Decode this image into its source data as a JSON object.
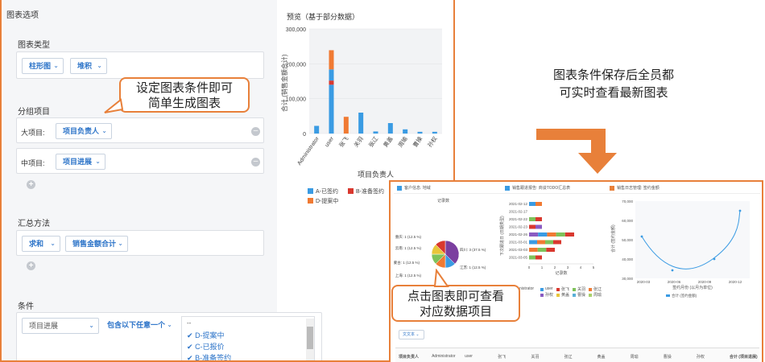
{
  "settings": {
    "title": "图表选项",
    "chart_type": {
      "title": "图表类型",
      "type_value": "柱形图",
      "mode_value": "堆积"
    },
    "grouping": {
      "title": "分组项目",
      "major_label": "大项目:",
      "major_value": "项目负责人",
      "minor_label": "中项目:",
      "minor_value": "项目进展"
    },
    "aggregation": {
      "title": "汇总方法",
      "method_value": "求和",
      "field_value": "销售金额合计"
    },
    "conditions": {
      "title": "条件",
      "field_value": "项目进展",
      "operator_value": "包含以下任意一个",
      "options": [
        "--",
        "D-提案中",
        "C-已报价",
        "B-准备签约"
      ],
      "checked": [
        false,
        true,
        true,
        true
      ]
    }
  },
  "callouts": {
    "left": [
      "设定图表条件即可",
      "简单生成图表"
    ],
    "bottom": [
      "点击图表即可查看",
      "对应数据项目"
    ],
    "caption": [
      "图表条件保存后全员都",
      "可实时查看最新图表"
    ]
  },
  "preview": {
    "title": "预览（基于部分数据）"
  },
  "chart_data": {
    "type": "bar",
    "stacked": true,
    "ylabel": "合计 (销售金额合计)",
    "xlabel": "项目负责人",
    "ylim": [
      0,
      300000
    ],
    "yticks": [
      "300,000",
      "200,000",
      "100,000",
      "0"
    ],
    "ytick_values": [
      300000,
      200000,
      100000,
      0
    ],
    "categories": [
      "Administrator",
      "user",
      "张飞",
      "关羽",
      "张辽",
      "黄盖",
      "周瑜",
      "曹操",
      "孙权"
    ],
    "series": [
      {
        "name": "A-已签约",
        "color": "#3a9be3",
        "values": [
          0,
          140000,
          0,
          0,
          0,
          0,
          0,
          0,
          0
        ]
      },
      {
        "name": "B-准备签约",
        "color": "#d9382e",
        "values": [
          0,
          12000,
          0,
          0,
          0,
          0,
          0,
          0,
          0
        ]
      },
      {
        "name": "C-已报价",
        "color": "#3a9be3",
        "values": [
          22000,
          32000,
          0,
          60000,
          6000,
          30000,
          12000,
          5000,
          5000
        ]
      },
      {
        "name": "D-提案中",
        "color": "#f07a33",
        "values": [
          0,
          55000,
          48000,
          0,
          0,
          0,
          0,
          0,
          0
        ]
      }
    ],
    "legend": [
      {
        "name": "A-已签约",
        "color": "#3a9be3"
      },
      {
        "name": "B-准备签约",
        "color": "#d9382e"
      },
      {
        "name": "D-提案中",
        "color": "#f07a33"
      }
    ]
  },
  "dashboard": {
    "cards": [
      {
        "title": "客户信息: 地域",
        "icon_color": "#3a9be3"
      },
      {
        "title": "销售跟进报告: 商谈TODO汇总表",
        "icon_color": "#3a9be3"
      },
      {
        "title": "销售日志管理: 签约金额",
        "icon_color": "#e8803a"
      }
    ],
    "pie": {
      "title": "记录数",
      "slices": [
        {
          "label": "四川: 3 (37.5 %)",
          "value": 3,
          "color": "#7b3fa0"
        },
        {
          "label": "江苏: 1 (12.5 %)",
          "value": 1,
          "color": "#3a9be3"
        },
        {
          "label": "上海: 1 (12.5 %)",
          "value": 1,
          "color": "#f07a33"
        },
        {
          "label": "内蒙古: 1 (12.5 %)",
          "value": 1,
          "color": "#7ec25a"
        },
        {
          "label": "云南: 1 (12.5 %)",
          "value": 1,
          "color": "#e8c53a"
        },
        {
          "label": "重庆: 1 (12.5 %)",
          "value": 1,
          "color": "#d9382e"
        }
      ]
    },
    "hbar": {
      "dates": [
        "2021-02-12",
        "2021-02-17",
        "2021-02-22",
        "2021-02-23",
        "2021-02-26",
        "2021-03-01",
        "2021-03-03",
        "2021-03-05"
      ],
      "values": [
        1,
        0,
        1,
        1,
        3.5,
        2.5,
        2,
        1
      ],
      "xlabel": "记录数",
      "xticks": [
        "0",
        "1",
        "2",
        "3",
        "4",
        "5"
      ],
      "ylabel": "下次跟进日 (日期类型)"
    },
    "line": {
      "yticks": [
        "70,000",
        "60,000",
        "50,000",
        "40,000",
        "30,000"
      ],
      "xticks": [
        "2020-03",
        "2020-06",
        "2020-09",
        "2020-12"
      ],
      "xlabel": "签约月份 (以月为单位)",
      "ylabel": "合计 (签约金额)",
      "legend": "合计 (签约金额)"
    },
    "table": {
      "filter_label": "文文本",
      "headers": [
        "项目负责人",
        "Administrator",
        "user",
        "张飞",
        "关羽",
        "张辽",
        "黄盖",
        "周瑜",
        "曹操",
        "孙权",
        "合计 (项目进展)"
      ]
    },
    "partial_legend": [
      "nistrator",
      "user",
      "张飞",
      "关羽",
      "张辽",
      "孙权",
      "黄盖",
      "曹操",
      "周瑜"
    ]
  }
}
